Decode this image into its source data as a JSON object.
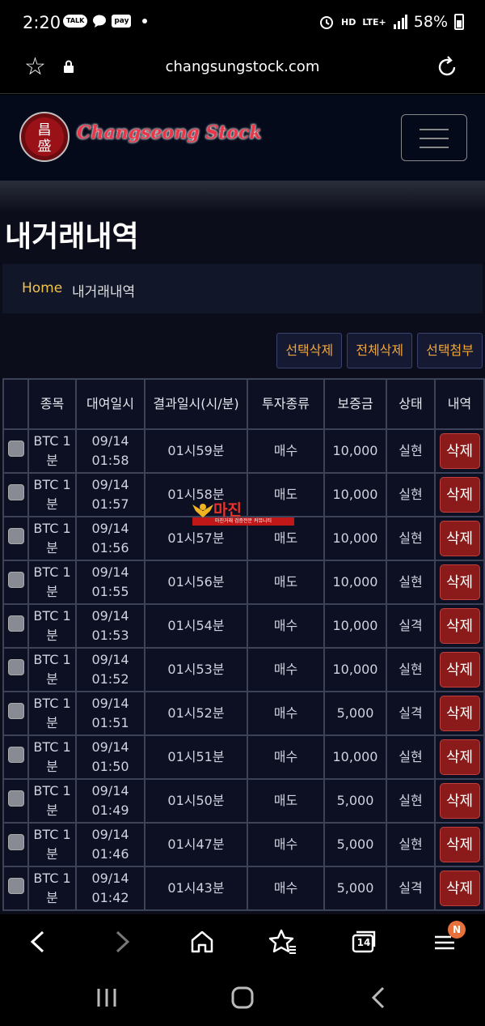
{
  "status_bar": {
    "time": "2:20",
    "talk": "TALK",
    "pay": "pay",
    "hd": "HD",
    "network": "LTE+",
    "battery": "58%"
  },
  "browser": {
    "url": "changsungstock.com"
  },
  "site": {
    "brand": "Changseong Stock",
    "emblem_chars": "昌盛"
  },
  "page": {
    "title": "내거래내역"
  },
  "breadcrumb": {
    "home": "Home",
    "current": "내거래내역"
  },
  "actions": {
    "delete_selected": "선택삭제",
    "delete_all": "전체삭제",
    "attach_selected": "선택첨부"
  },
  "table": {
    "headers": {
      "symbol": "종목",
      "rent_time": "대여일시",
      "result_time": "결과일시(시/분)",
      "type": "투자종류",
      "margin": "보증금",
      "status": "상태",
      "detail": "내역"
    },
    "delete_label": "삭제",
    "rows": [
      {
        "symbol": "BTC 1분",
        "rent_date": "09/14",
        "rent_time": "01:58",
        "result": "01시59분",
        "type": "매수",
        "margin": "10,000",
        "status": "실현",
        "win": true
      },
      {
        "symbol": "BTC 1분",
        "rent_date": "09/14",
        "rent_time": "01:57",
        "result": "01시58분",
        "type": "매도",
        "margin": "10,000",
        "status": "실현",
        "win": true
      },
      {
        "symbol": "BTC 1분",
        "rent_date": "09/14",
        "rent_time": "01:56",
        "result": "01시57분",
        "type": "매도",
        "margin": "10,000",
        "status": "실현",
        "win": true
      },
      {
        "symbol": "BTC 1분",
        "rent_date": "09/14",
        "rent_time": "01:55",
        "result": "01시56분",
        "type": "매도",
        "margin": "10,000",
        "status": "실현",
        "win": true
      },
      {
        "symbol": "BTC 1분",
        "rent_date": "09/14",
        "rent_time": "01:53",
        "result": "01시54분",
        "type": "매수",
        "margin": "10,000",
        "status": "실격",
        "win": false
      },
      {
        "symbol": "BTC 1분",
        "rent_date": "09/14",
        "rent_time": "01:52",
        "result": "01시53분",
        "type": "매수",
        "margin": "10,000",
        "status": "실현",
        "win": true
      },
      {
        "symbol": "BTC 1분",
        "rent_date": "09/14",
        "rent_time": "01:51",
        "result": "01시52분",
        "type": "매수",
        "margin": "5,000",
        "status": "실격",
        "win": false
      },
      {
        "symbol": "BTC 1분",
        "rent_date": "09/14",
        "rent_time": "01:50",
        "result": "01시51분",
        "type": "매수",
        "margin": "10,000",
        "status": "실현",
        "win": true
      },
      {
        "symbol": "BTC 1분",
        "rent_date": "09/14",
        "rent_time": "01:49",
        "result": "01시50분",
        "type": "매도",
        "margin": "5,000",
        "status": "실현",
        "win": true
      },
      {
        "symbol": "BTC 1분",
        "rent_date": "09/14",
        "rent_time": "01:46",
        "result": "01시47분",
        "type": "매수",
        "margin": "5,000",
        "status": "실현",
        "win": true
      },
      {
        "symbol": "BTC 1분",
        "rent_date": "09/14",
        "rent_time": "01:42",
        "result": "01시43분",
        "type": "매수",
        "margin": "5,000",
        "status": "실격",
        "win": false
      }
    ]
  },
  "watermark": {
    "text": "마진",
    "sub": "마진거래 검증전문 커뮤니티"
  },
  "bottom_nav": {
    "tabs_count": "14",
    "menu_badge": "N"
  },
  "colors": {
    "win": "#7ad67a",
    "lose": "#e86060",
    "delete_button": "#8b1a1a",
    "action_text": "#f0a63a",
    "breadcrumb_home": "#f0c34a"
  }
}
